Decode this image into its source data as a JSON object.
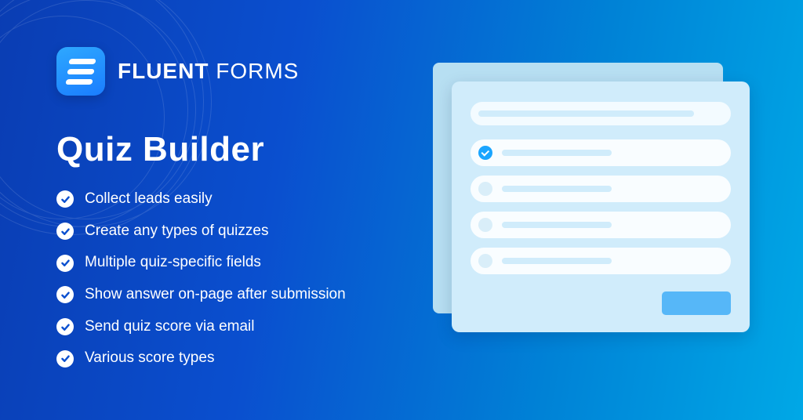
{
  "brand": {
    "strong": "FLUENT",
    "light": "FORMS"
  },
  "heading": "Quiz Builder",
  "features": [
    "Collect leads easily",
    "Create any types of quizzes",
    "Multiple quiz-specific fields",
    "Show answer on-page after submission",
    "Send quiz score via email",
    "Various score types"
  ]
}
